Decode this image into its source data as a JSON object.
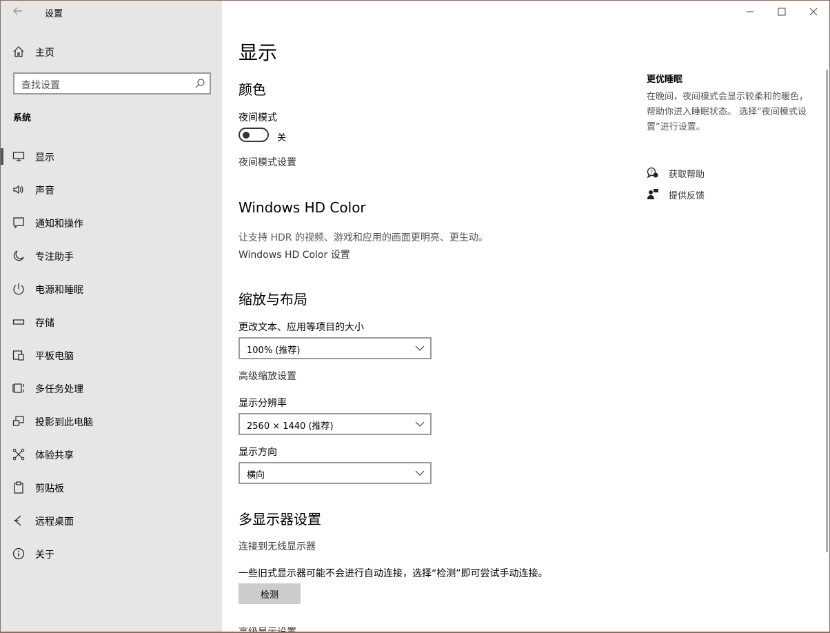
{
  "window": {
    "title": "设置",
    "back_icon": "arrow-left-icon",
    "controls": [
      "minimize-icon",
      "maximize-icon",
      "close-icon"
    ]
  },
  "sidebar": {
    "home_label": "主页",
    "search_placeholder": "查找设置",
    "section": "系统",
    "items": [
      {
        "label": "显示",
        "icon": "monitor-icon",
        "active": true
      },
      {
        "label": "声音",
        "icon": "speaker-icon"
      },
      {
        "label": "通知和操作",
        "icon": "notification-icon"
      },
      {
        "label": "专注助手",
        "icon": "moon-icon"
      },
      {
        "label": "电源和睡眠",
        "icon": "power-icon"
      },
      {
        "label": "存储",
        "icon": "storage-icon"
      },
      {
        "label": "平板电脑",
        "icon": "tablet-icon"
      },
      {
        "label": "多任务处理",
        "icon": "multitask-icon"
      },
      {
        "label": "投影到此电脑",
        "icon": "project-icon"
      },
      {
        "label": "体验共享",
        "icon": "share-icon"
      },
      {
        "label": "剪贴板",
        "icon": "clipboard-icon"
      },
      {
        "label": "远程桌面",
        "icon": "remote-icon"
      },
      {
        "label": "关于",
        "icon": "info-icon"
      }
    ]
  },
  "main": {
    "page_title": "显示",
    "color": {
      "heading": "颜色",
      "night_label": "夜间模式",
      "toggle_state": "关",
      "night_settings_link": "夜间模式设置"
    },
    "hdr": {
      "heading": "Windows HD Color",
      "description": "让支持 HDR 的视频、游戏和应用的画面更明亮、更生动。",
      "settings_link": "Windows HD Color 设置"
    },
    "scale": {
      "heading": "缩放与布局",
      "size_label": "更改文本、应用等项目的大小",
      "size_value": "100% (推荐)",
      "advanced_link": "高级缩放设置",
      "resolution_label": "显示分辨率",
      "resolution_value": "2560 × 1440 (推荐)",
      "orientation_label": "显示方向",
      "orientation_value": "横向"
    },
    "multi": {
      "heading": "多显示器设置",
      "wireless_link": "连接到无线显示器",
      "description": "一些旧式显示器可能不会进行自动连接，选择“检测”即可尝试手动连接。",
      "detect_button": "检测",
      "advanced_link": "高级显示设置"
    }
  },
  "aside": {
    "title": "更优睡眠",
    "description": "在晚间，夜间模式会显示较柔和的暖色，帮助你进入睡眠状态。 选择“夜间模式设置”进行设置。",
    "help_link": "获取帮助",
    "feedback_link": "提供反馈"
  }
}
